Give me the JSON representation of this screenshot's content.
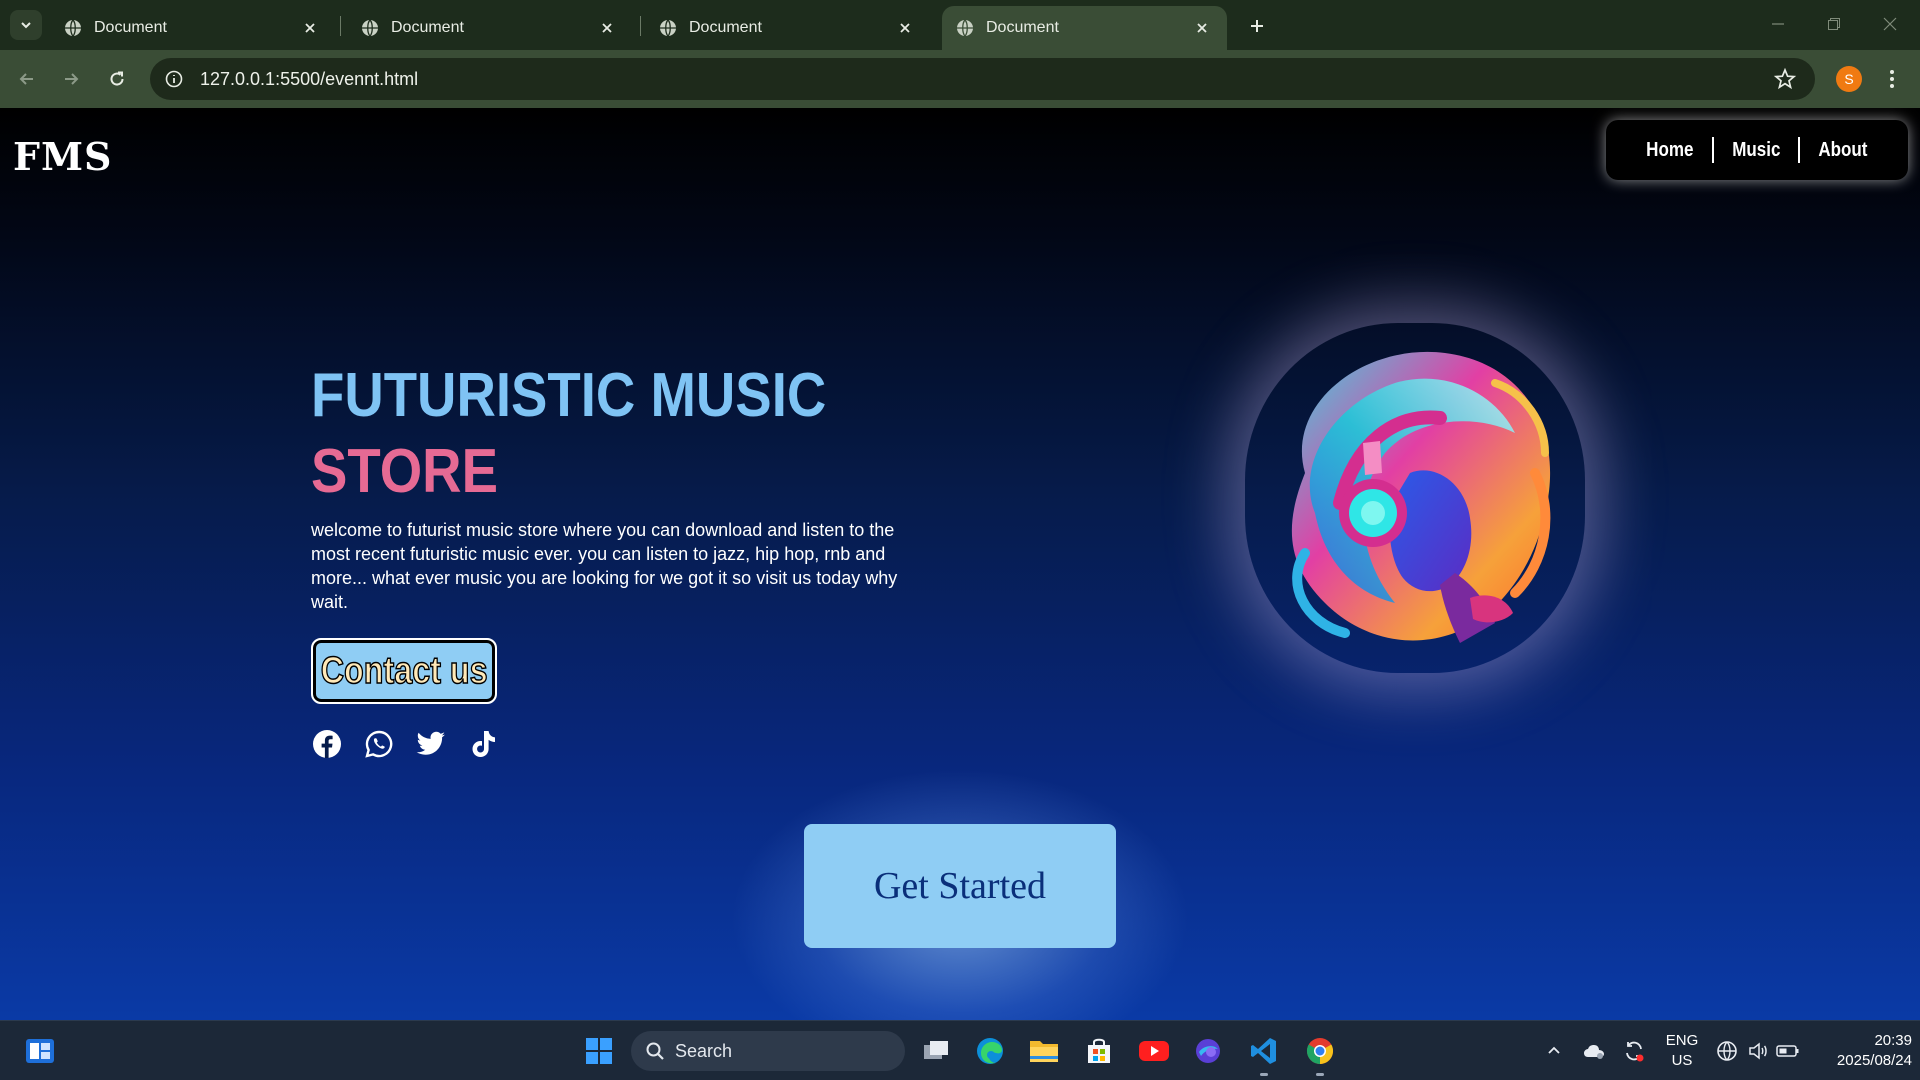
{
  "browser": {
    "tabs": [
      {
        "title": "Document",
        "active": false
      },
      {
        "title": "Document",
        "active": false
      },
      {
        "title": "Document",
        "active": false
      },
      {
        "title": "Document",
        "active": true
      }
    ],
    "url": "127.0.0.1:5500/evennt.html",
    "profile_initial": "S"
  },
  "page": {
    "logo": "FMS",
    "nav": [
      "Home",
      "Music",
      "About"
    ],
    "hero": {
      "title_line1": "FUTURISTIC MUSIC",
      "title_line2": "STORE",
      "description": "welcome to futurist music store where you can download and listen to the most recent futuristic music ever. you can listen to jazz, hip hop, rnb and more... what ever music you are looking for we got it so visit us today why wait.",
      "contact_label": "Contact us",
      "socials": [
        "facebook-icon",
        "whatsapp-icon",
        "twitter-icon",
        "tiktok-icon"
      ]
    },
    "cta_label": "Get Started",
    "colors": {
      "title_primary": "#7fc3f4",
      "title_accent": "#e66a94",
      "button_bg": "#8fcdf4"
    }
  },
  "taskbar": {
    "search_label": "Search",
    "apps": [
      "task-view-icon",
      "edge-icon",
      "file-explorer-icon",
      "microsoft-store-icon",
      "youtube-icon",
      "copilot-icon",
      "vscode-icon",
      "chrome-icon"
    ],
    "lang_line1": "ENG",
    "lang_line2": "US",
    "time": "20:39",
    "date": "2025/08/24"
  }
}
